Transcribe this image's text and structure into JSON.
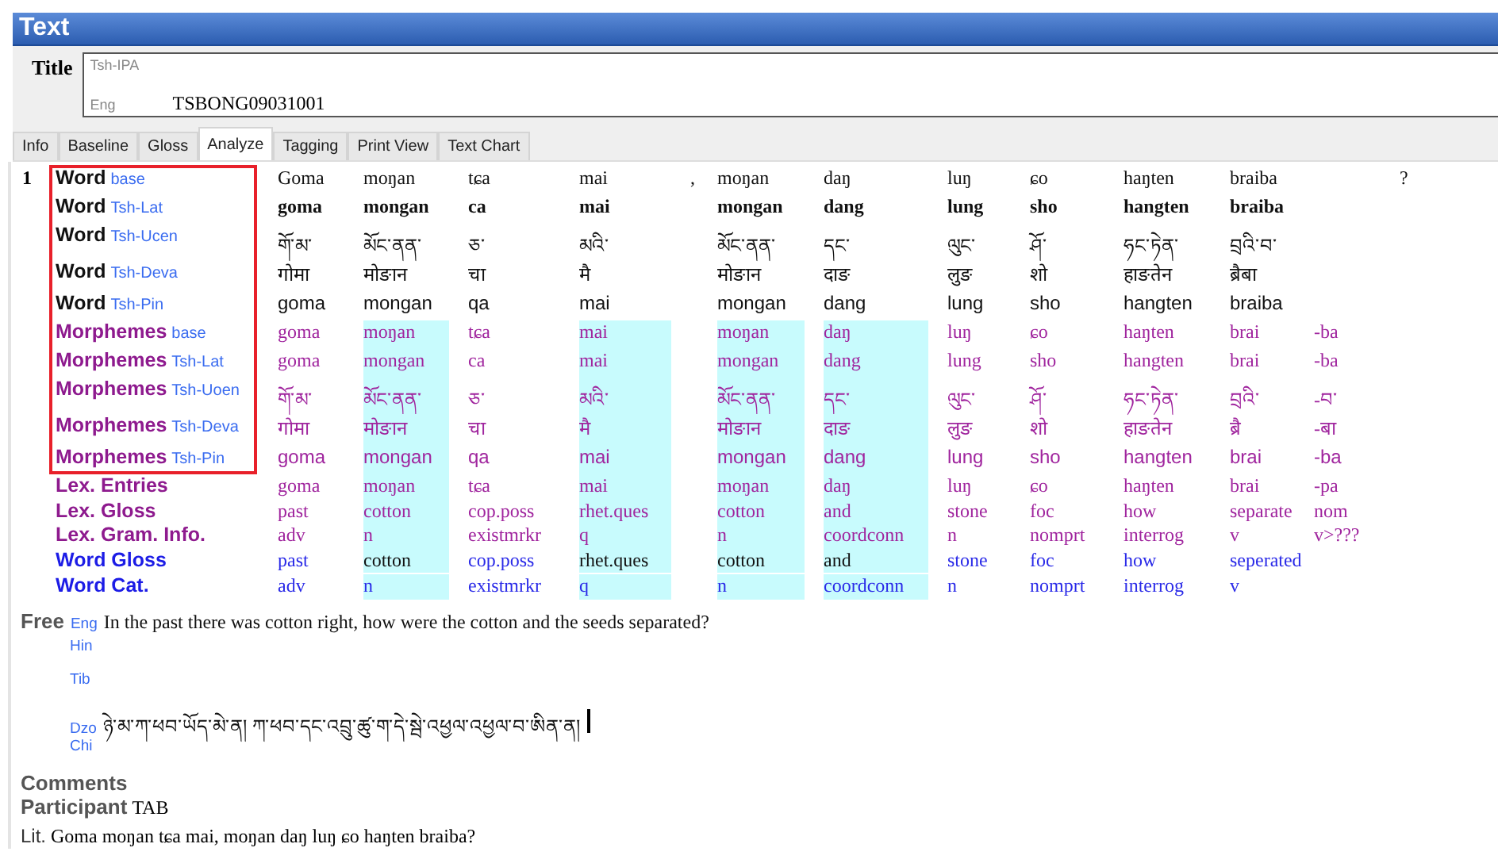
{
  "header": {
    "title": "Text"
  },
  "title_field": {
    "label": "Title",
    "lines": [
      {
        "ws": "Tsh-IPA"
      },
      {
        "ws": "Eng",
        "value": "TSBONG09031001"
      }
    ]
  },
  "tabs": [
    {
      "label": "Info",
      "selected": false
    },
    {
      "label": "Baseline",
      "selected": false
    },
    {
      "label": "Gloss",
      "selected": false
    },
    {
      "label": "Analyze",
      "selected": true
    },
    {
      "label": "Tagging",
      "selected": false
    },
    {
      "label": "Print View",
      "selected": false
    },
    {
      "label": "Text Chart",
      "selected": false
    }
  ],
  "segment": {
    "number": "1",
    "columns": [
      {
        "highlighted": false
      },
      {
        "highlighted": true
      },
      {
        "highlighted": false
      },
      {
        "highlighted": true
      },
      {
        "highlighted": false
      },
      {
        "highlighted": true
      },
      {
        "highlighted": true
      },
      {
        "highlighted": false
      },
      {
        "highlighted": false
      },
      {
        "highlighted": false
      },
      {
        "highlighted": false
      },
      {
        "highlighted": false
      },
      {
        "highlighted": false
      }
    ],
    "rows": [
      {
        "kind": "word",
        "label": "Word",
        "ws": "base",
        "cells": [
          "Goma",
          "moŋan",
          "tɕa",
          "mai",
          ",",
          "moŋan",
          "daŋ",
          "luŋ",
          "ɕo",
          "haŋten",
          "braiba",
          null,
          "?"
        ]
      },
      {
        "kind": "word",
        "label": "Word",
        "ws": "Tsh-Lat",
        "cells": [
          "goma",
          "mongan",
          "ca",
          "mai",
          null,
          "mongan",
          "dang",
          "lung",
          "sho",
          "hangten",
          "braiba",
          null,
          null
        ]
      },
      {
        "kind": "word",
        "label": "Word",
        "ws": "Tsh-Ucen",
        "cells": [
          "གོ་མ་",
          "མོང་ནན་",
          "ཅ་",
          "མའི་",
          null,
          "མོང་ནན་",
          "དང་",
          "ལུང་",
          "ཤོ་",
          "ཧང་ཏེན་",
          "བྲའི་བ་",
          null,
          null
        ]
      },
      {
        "kind": "word",
        "label": "Word",
        "ws": "Tsh-Deva",
        "cells": [
          "गोमा",
          "मोङान",
          "चा",
          "मै",
          null,
          "मोङान",
          "दाङ",
          "लुङ",
          "शो",
          "हाङतेन",
          "ब्रैबा",
          null,
          null
        ]
      },
      {
        "kind": "word",
        "label": "Word",
        "ws": "Tsh-Pin",
        "cells": [
          "goma",
          "mongan",
          "qa",
          "mai",
          null,
          "mongan",
          "dang",
          "lung",
          "sho",
          "hangten",
          "braiba",
          null,
          null
        ]
      },
      {
        "kind": "morpheme",
        "label": "Morphemes",
        "ws": "base",
        "cells": [
          "goma",
          "moŋan",
          "tɕa",
          "mai",
          null,
          "moŋan",
          "daŋ",
          "luŋ",
          "ɕo",
          "haŋten",
          "brai",
          "-ba",
          null
        ]
      },
      {
        "kind": "morpheme",
        "label": "Morphemes",
        "ws": "Tsh-Lat",
        "cells": [
          "goma",
          "mongan",
          "ca",
          "mai",
          null,
          "mongan",
          "dang",
          "lung",
          "sho",
          "hangten",
          "brai",
          "-ba",
          null
        ]
      },
      {
        "kind": "morpheme",
        "label": "Morphemes",
        "ws": "Tsh-Uoen",
        "cells": [
          "གོ་མ་",
          "མོང་ནན་",
          "ཅ་",
          "མའི་",
          null,
          "མོང་ནན་",
          "དང་",
          "ལུང་",
          "ཤོ་",
          "ཧང་ཏེན་",
          "བྲའི་",
          "-བ་",
          null
        ]
      },
      {
        "kind": "morpheme",
        "label": "Morphemes",
        "ws": "Tsh-Deva",
        "cells": [
          "गोमा",
          "मोङान",
          "चा",
          "मै",
          null,
          "मोङान",
          "दाङ",
          "लुङ",
          "शो",
          "हाङतेन",
          "ब्रै",
          "-बा",
          null
        ]
      },
      {
        "kind": "morpheme",
        "label": "Morphemes",
        "ws": "Tsh-Pin",
        "cells": [
          "goma",
          "mongan",
          "qa",
          "mai",
          null,
          "mongan",
          "dang",
          "lung",
          "sho",
          "hangten",
          "brai",
          "-ba",
          null
        ]
      },
      {
        "kind": "lex",
        "label": "Lex. Entries",
        "cells": [
          "goma",
          "moŋan",
          "tɕa",
          "mai",
          null,
          "moŋan",
          "daŋ",
          "luŋ",
          "ɕo",
          "haŋten",
          "brai",
          "-pa",
          null
        ]
      },
      {
        "kind": "lex",
        "label": "Lex. Gloss",
        "cells": [
          "past",
          "cotton",
          "cop.poss",
          "rhet.ques",
          null,
          "cotton",
          "and",
          "stone",
          "foc",
          "how",
          "separate",
          "nom",
          null
        ]
      },
      {
        "kind": "lex",
        "label": "Lex. Gram. Info.",
        "cells": [
          "adv",
          "n",
          "existmrkr",
          "q",
          null,
          "n",
          "coordconn",
          "n",
          "nomprt",
          "interrog",
          "v",
          "v>???",
          null
        ]
      },
      {
        "kind": "word_gloss",
        "label": "Word Gloss",
        "cells": [
          "past",
          "cotton",
          "cop.poss",
          "rhet.ques",
          null,
          "cotton",
          "and",
          "stone",
          "foc",
          "how",
          "seperated",
          null,
          null
        ]
      },
      {
        "kind": "word_cat",
        "label": "Word Cat.",
        "cells": [
          "adv",
          "n",
          "existmrkr",
          "q",
          null,
          "n",
          "coordconn",
          "n",
          "nomprt",
          "interrog",
          "v",
          null,
          null
        ]
      }
    ]
  },
  "free": {
    "label": "Free",
    "lines": [
      {
        "ws": "Eng",
        "text": "In the past there was cotton right, how were the cotton and the seeds separated?",
        "caret": false
      },
      {
        "ws": "Hin",
        "caret": false
      },
      {
        "ws": "Tib",
        "caret": false
      },
      {
        "ws": "Dzo",
        "text": "ཉེ་མ་ཀ་ཕབ་ཡོད་མེ་ན།  ཀ་ཕབ་དང་འབྲུ་ཚུ་ག་དེ་སྦེ་འཕྱལ་འཕྱལ་བ་ཨིན་ན།",
        "caret": true
      },
      {
        "ws": "Chi",
        "caret": false
      }
    ]
  },
  "comments": {
    "label": "Comments"
  },
  "participant": {
    "label": "Participant",
    "value": "TAB"
  },
  "literal": {
    "label": "Lit.",
    "text": "Goma moŋan tɕa mai, moŋan daŋ luŋ ɕo haŋten braiba?"
  }
}
